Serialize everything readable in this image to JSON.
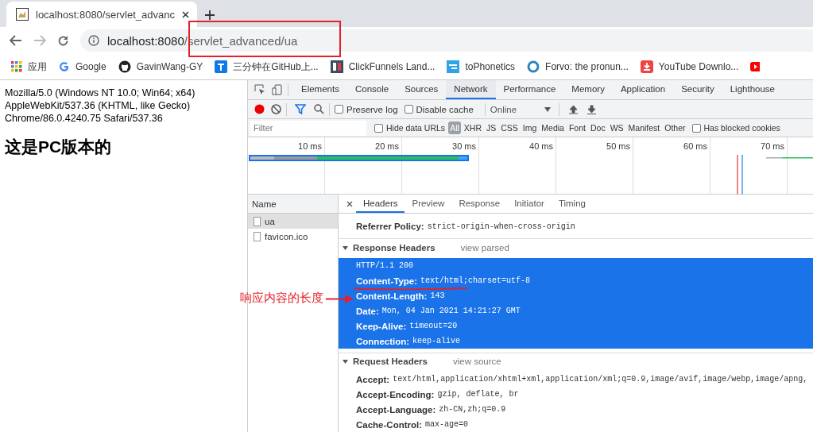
{
  "browser": {
    "tabs": [
      {
        "title": "localhost:8080/servlet_advanc",
        "selected": true
      }
    ],
    "address": {
      "host": "localhost:8080",
      "path": "/servlet_advanced/ua"
    },
    "bookmarks": [
      {
        "kind": "apps",
        "label": "应用"
      },
      {
        "kind": "google",
        "label": "Google"
      },
      {
        "kind": "github",
        "label": "GavinWang-GY"
      },
      {
        "kind": "zhihu",
        "label": "三分钟在GitHub上..."
      },
      {
        "kind": "clickfunnels",
        "label": "ClickFunnels Land..."
      },
      {
        "kind": "textdat",
        "label": "toPhonetics"
      },
      {
        "kind": "forvo",
        "label": "Forvo: the pronun..."
      },
      {
        "kind": "download",
        "label": "YouTube Downlo..."
      },
      {
        "kind": "youtube"
      }
    ]
  },
  "page": {
    "lines": [
      "Mozilla/5.0 (Windows NT 10.0; Win64; x64)",
      "AppleWebKit/537.36 (KHTML, like Gecko)",
      "Chrome/86.0.4240.75 Safari/537.36"
    ],
    "heading": "这是PC版本的"
  },
  "devtools": {
    "panels": [
      {
        "label": "Elements",
        "selected": false
      },
      {
        "label": "Console",
        "selected": false
      },
      {
        "label": "Sources",
        "selected": false
      },
      {
        "label": "Network",
        "selected": true
      },
      {
        "label": "Performance",
        "selected": false
      },
      {
        "label": "Memory",
        "selected": false
      },
      {
        "label": "Application",
        "selected": false
      },
      {
        "label": "Security",
        "selected": false
      },
      {
        "label": "Lighthouse",
        "selected": false
      }
    ],
    "recording": true,
    "preserve_log": {
      "label": "Preserve log",
      "checked": false
    },
    "disable_cache": {
      "label": "Disable cache",
      "checked": false
    },
    "throttling": "Online",
    "filter": {
      "placeholder": "Filter",
      "hide_data_urls": {
        "label": "Hide data URLs",
        "checked": false
      },
      "types": [
        {
          "label": "All",
          "selected": true
        },
        {
          "label": "XHR",
          "selected": false
        },
        {
          "label": "JS",
          "selected": false
        },
        {
          "label": "CSS",
          "selected": false
        },
        {
          "label": "Img",
          "selected": false
        },
        {
          "label": "Media",
          "selected": false
        },
        {
          "label": "Font",
          "selected": false
        },
        {
          "label": "Doc",
          "selected": false
        },
        {
          "label": "WS",
          "selected": false
        },
        {
          "label": "Manifest",
          "selected": false
        },
        {
          "label": "Other",
          "selected": false
        }
      ],
      "blocked_cookies": {
        "label": "Has blocked cookies",
        "checked": false
      }
    },
    "timeline": {
      "ticks": [
        "10 ms",
        "20 ms",
        "30 ms",
        "40 ms",
        "50 ms",
        "60 ms",
        "70 ms"
      ]
    },
    "name_header": "Name",
    "requests": [
      {
        "name": "ua",
        "selected": true
      },
      {
        "name": "favicon.ico",
        "selected": false
      }
    ],
    "detail_tabs": [
      {
        "label": "Headers",
        "selected": true
      },
      {
        "label": "Preview",
        "selected": false
      },
      {
        "label": "Response",
        "selected": false
      },
      {
        "label": "Initiator",
        "selected": false
      },
      {
        "label": "Timing",
        "selected": false
      }
    ],
    "general": [
      {
        "name": "Referrer Policy:",
        "value": "strict-origin-when-cross-origin"
      }
    ],
    "response_headers": {
      "title": "Response Headers",
      "link": "view parsed",
      "expanded": true,
      "selected": true,
      "rows": [
        {
          "name": "HTTP/1.1 200"
        },
        {
          "name": "Content-Type:",
          "value": "text/html;charset=utf-8"
        },
        {
          "name": "Content-Length:",
          "value": "143"
        },
        {
          "name": "Date:",
          "value": "Mon, 04 Jan 2021 14:21:27 GMT"
        },
        {
          "name": "Keep-Alive:",
          "value": "timeout=20"
        },
        {
          "name": "Connection:",
          "value": "keep-alive"
        }
      ]
    },
    "request_headers": {
      "title": "Request Headers",
      "link": "view source",
      "expanded": true,
      "selected": false,
      "rows": [
        {
          "name": "Accept:",
          "value": "text/html,application/xhtml+xml,application/xml;q=0.9,image/avif,image/webp,image/apng,"
        },
        {
          "name": "Accept-Encoding:",
          "value": "gzip, deflate, br"
        },
        {
          "name": "Accept-Language:",
          "value": "zh-CN,zh;q=0.9"
        },
        {
          "name": "Cache-Control:",
          "value": "max-age=0"
        }
      ]
    }
  },
  "annotation": {
    "text": "响应内容的长度"
  }
}
